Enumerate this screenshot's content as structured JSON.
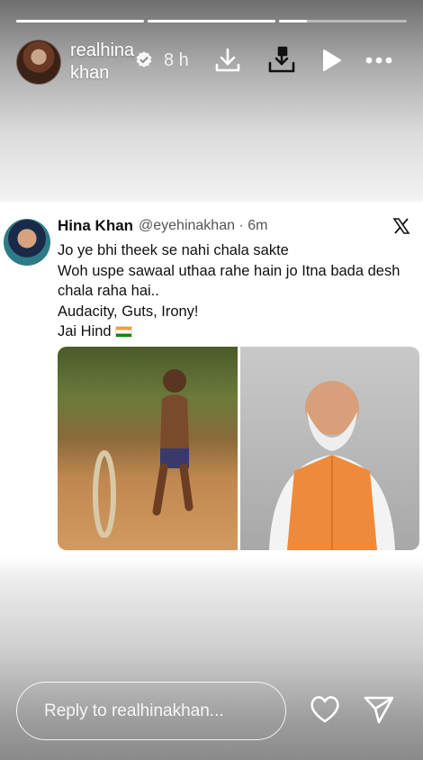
{
  "story": {
    "progress": [
      1,
      1,
      0.22
    ],
    "username": "realhinakhan",
    "time": "8 h",
    "reply_placeholder": "Reply to realhinakhan..."
  },
  "tweet": {
    "name": "Hina Khan",
    "handle": "@eyehinakhan · 6m",
    "lines": [
      "Jo ye bhi theek se nahi chala sakte",
      "Woh uspe sawaal uthaa rahe hain jo Itna bada desh",
      "chala raha hai..",
      "Audacity, Guts, Irony!",
      "Jai Hind"
    ]
  },
  "icons": {
    "verified": "verified-icon",
    "download": "download-icon",
    "save": "save-icon",
    "play": "play-icon",
    "more": "more-icon",
    "x": "x-logo-icon",
    "like": "heart-icon",
    "share": "send-icon"
  }
}
